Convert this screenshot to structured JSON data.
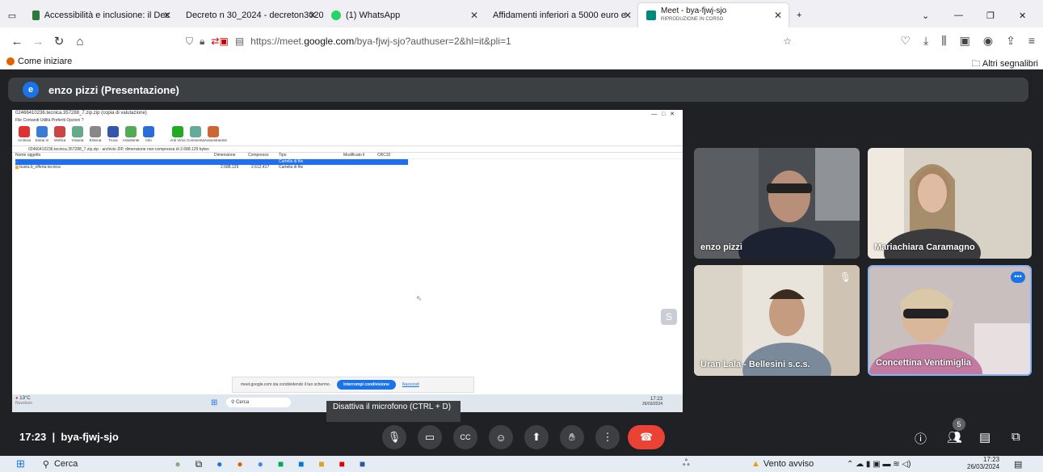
{
  "tabs": [
    {
      "label": "Accessibilità e inclusione: il Dec",
      "color": "#2a7a3b"
    },
    {
      "label": "Decreto n 30_2024 - decreton30202",
      "color": "#7b7b7b"
    },
    {
      "label": "(1) WhatsApp",
      "color": "#25d366"
    },
    {
      "label": "Affidamenti inferiori a 5000 euro e",
      "color": "#7b7b7b"
    },
    {
      "label": "Meet - bya-fjwj-sjo",
      "sub": "RIPRODUZIONE IN CORSO",
      "color": "#00897b"
    }
  ],
  "url": {
    "prefix": "https://meet.",
    "domain": "google.com",
    "rest": "/bya-fjwj-sjo?authuser=2&hl=it&pli=1"
  },
  "bookmarks": {
    "left": "Come iniziare",
    "right": "Altri segnalibri"
  },
  "presenter": {
    "initial": "e",
    "label": "enzo pizzi (Presentazione)"
  },
  "shared": {
    "title": "02466410236.tecnica.357288_7.zip.zip (copia di valutazione)",
    "menu": "File  Comandi  Utilità  Preferiti  Opzioni  ?",
    "tools": [
      "Archivia",
      "Estrai in",
      "Verifica",
      "Visiona",
      "Elimina",
      "Trova",
      "Assistente",
      "Info",
      "Anti Virus",
      "Commenta",
      "Autoestraente"
    ],
    "path": "02466410236.tecnica.357288_7.zip.zip - archivio ZIP, dimensione non-compressa di 2.688.129 bytes",
    "columns": [
      "Nome oggetto",
      "Dimensione",
      "Compresso",
      "Tipo",
      "Modificato il",
      "CRC32"
    ],
    "rows": [
      {
        "name": "..",
        "size": "",
        "packed": "",
        "type": "Cartella di file"
      },
      {
        "name": "busta b_offerta tecnica",
        "size": "2.688.129",
        "packed": "2.612.417",
        "type": "Cartella di file"
      }
    ],
    "notice": "meet.google.com sta condividendo il tuo schermo.",
    "stop_share": "Interrompi condivisione",
    "hide": "Nascondi",
    "weather": "13°C",
    "weather_sub": "Nuvoloso",
    "search": "Cerca",
    "time": "17:23",
    "date": "26/03/2024"
  },
  "participants": [
    {
      "name": "enzo pizzi",
      "bg": "#4a4d52",
      "muted": false
    },
    {
      "name": "Mariachiara Caramagno",
      "bg": "#c9c2b8",
      "muted": false
    },
    {
      "name": "Uran Lala - Bellesini s.c.s.",
      "bg": "#8b7a68",
      "muted": true
    },
    {
      "name": "Concettina Ventimiglia",
      "bg": "#b7a7a8",
      "muted": false
    }
  ],
  "tooltip": "Disattiva il microfono (CTRL + D)",
  "meeting": {
    "time": "17:23",
    "code": "bya-fjwj-sjo",
    "people_count": "5"
  },
  "controls": {
    "accent": "#ea4335"
  },
  "taskbar": {
    "search": "Cerca",
    "weather": "Vento avviso",
    "time": "17:23",
    "date": "26/03/2024"
  }
}
